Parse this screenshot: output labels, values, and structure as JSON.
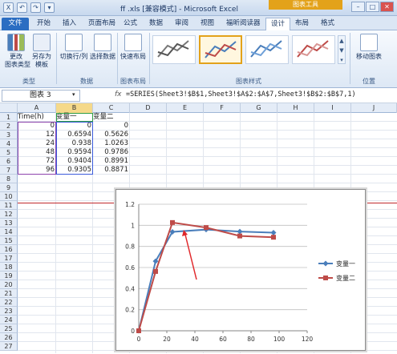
{
  "window": {
    "title": "ff .xls [兼容模式] - Microsoft Excel",
    "chart_tools_badge": "图表工具"
  },
  "quick_access": [
    "X",
    "↶",
    "↷",
    "▾"
  ],
  "tabs": [
    {
      "label": "文件",
      "kind": "file"
    },
    {
      "label": "开始"
    },
    {
      "label": "插入"
    },
    {
      "label": "页面布局"
    },
    {
      "label": "公式"
    },
    {
      "label": "数据"
    },
    {
      "label": "审阅"
    },
    {
      "label": "视图"
    },
    {
      "label": "福昕阅读器"
    },
    {
      "label": "设计",
      "active": true
    },
    {
      "label": "布局"
    },
    {
      "label": "格式"
    }
  ],
  "ribbon": {
    "type_group": {
      "label": "类型",
      "change_type": "更改\n图表类型",
      "save_template": "另存为\n模板"
    },
    "data_group": {
      "label": "数据",
      "switch_row_col": "切换行/列",
      "select_data": "选择数据"
    },
    "layout_group": {
      "label": "图表布局",
      "quick_layout": "快速布局"
    },
    "styles_group": {
      "label": "图表样式"
    },
    "location_group": {
      "label": "位置",
      "move_chart": "移动图表"
    }
  },
  "formula_bar": {
    "name_box": "图表 3",
    "fx": "fx",
    "formula": "=SERIES(Sheet3!$B$1,Sheet3!$A$2:$A$7,Sheet3!$B$2:$B$7,1)"
  },
  "columns": [
    "A",
    "B",
    "C",
    "D",
    "E",
    "F",
    "G",
    "H",
    "I",
    "J"
  ],
  "rows": [
    "1",
    "2",
    "3",
    "4",
    "5",
    "6",
    "7",
    "8",
    "9",
    "10",
    "11",
    "12",
    "13",
    "14",
    "15",
    "16",
    "17",
    "18",
    "19",
    "20",
    "21",
    "22",
    "23",
    "24",
    "25",
    "26",
    "27"
  ],
  "table": {
    "headers": [
      "Time(h)",
      "变量一",
      "变量二"
    ],
    "rows": [
      [
        "0",
        "0",
        "0"
      ],
      [
        "12",
        "0.6594",
        "0.5626"
      ],
      [
        "24",
        "0.938",
        "1.0263"
      ],
      [
        "48",
        "0.9594",
        "0.9786"
      ],
      [
        "72",
        "0.9404",
        "0.8991"
      ],
      [
        "96",
        "0.9305",
        "0.8871"
      ]
    ]
  },
  "chart_data": {
    "type": "line",
    "title": "",
    "xlabel": "",
    "ylabel": "",
    "xlim": [
      0,
      120
    ],
    "ylim": [
      0,
      1.2
    ],
    "x_ticks": [
      "0",
      "20",
      "40",
      "60",
      "80",
      "100",
      "120"
    ],
    "y_ticks": [
      "0",
      "0.2",
      "0.4",
      "0.6",
      "0.8",
      "1",
      "1.2"
    ],
    "grid": "horizontal",
    "legend": "right",
    "series": [
      {
        "name": "变量一",
        "color": "#4a7ebb",
        "marker": "diamond",
        "x": [
          0,
          12,
          24,
          48,
          72,
          96
        ],
        "y": [
          0,
          0.6594,
          0.938,
          0.9594,
          0.9404,
          0.9305
        ]
      },
      {
        "name": "变量二",
        "color": "#be4b48",
        "marker": "square",
        "x": [
          0,
          12,
          24,
          48,
          72,
          96
        ],
        "y": [
          0,
          0.5626,
          1.0263,
          0.9786,
          0.8991,
          0.8871
        ]
      }
    ],
    "annotation_arrow_color": "#e0282b"
  }
}
